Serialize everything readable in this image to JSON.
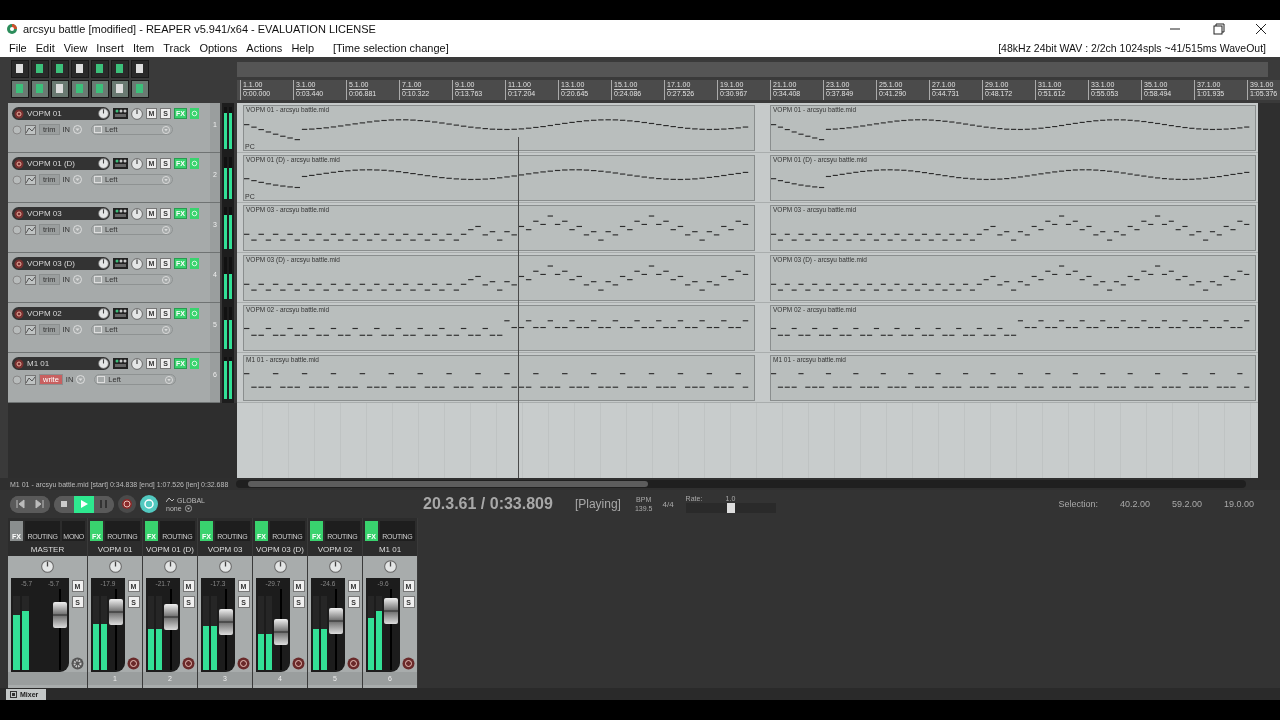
{
  "window": {
    "title": "arcsyu battle [modified] - REAPER v5.941/x64 - EVALUATION LICENSE"
  },
  "menu": [
    "File",
    "Edit",
    "View",
    "Insert",
    "Item",
    "Track",
    "Options",
    "Actions",
    "Help"
  ],
  "last_action": "[Time selection change]",
  "audio_status": "[48kHz 24bit WAV : 2/2ch 1024spls ~41/515ms WaveOut]",
  "ruler": [
    {
      "bar": "1.1.00",
      "time": "0:00.000"
    },
    {
      "bar": "3.1.00",
      "time": "0:03.440"
    },
    {
      "bar": "5.1.00",
      "time": "0:06.881"
    },
    {
      "bar": "7.1.00",
      "time": "0:10.322"
    },
    {
      "bar": "9.1.00",
      "time": "0:13.763"
    },
    {
      "bar": "11.1.00",
      "time": "0:17.204"
    },
    {
      "bar": "13.1.00",
      "time": "0:20.645"
    },
    {
      "bar": "15.1.00",
      "time": "0:24.086"
    },
    {
      "bar": "17.1.00",
      "time": "0:27.526"
    },
    {
      "bar": "19.1.00",
      "time": "0:30.967"
    },
    {
      "bar": "21.1.00",
      "time": "0:34.408"
    },
    {
      "bar": "23.1.00",
      "time": "0:37.849"
    },
    {
      "bar": "25.1.00",
      "time": "0:41.290"
    },
    {
      "bar": "27.1.00",
      "time": "0:44.731"
    },
    {
      "bar": "29.1.00",
      "time": "0:48.172"
    },
    {
      "bar": "31.1.00",
      "time": "0:51.612"
    },
    {
      "bar": "33.1.00",
      "time": "0:55.053"
    },
    {
      "bar": "35.1.00",
      "time": "0:58.494"
    },
    {
      "bar": "37.1.00",
      "time": "1:01.935"
    },
    {
      "bar": "39.1.00",
      "time": "1:05.376"
    }
  ],
  "tracks": [
    {
      "number": "1",
      "name": "VOPM 01",
      "automation": "trim",
      "automation_write": false,
      "input": "IN",
      "output": "Left",
      "mute": "M",
      "solo": "S",
      "fx": "FX",
      "level": 0.85,
      "clips": [
        {
          "name": "VOPM 01 - arcsyu battle.mid",
          "marker": "PC"
        },
        {
          "name": "VOPM 01 - arcsyu battle.mid"
        }
      ]
    },
    {
      "number": "2",
      "name": "VOPM 01 (D)",
      "automation": "trim",
      "automation_write": false,
      "input": "IN",
      "output": "Left",
      "mute": "M",
      "solo": "S",
      "fx": "FX",
      "level": 0.75,
      "clips": [
        {
          "name": "VOPM 01 (D) - arcsyu battle.mid",
          "marker": "PC"
        },
        {
          "name": "VOPM 01 (D) - arcsyu battle.mid"
        }
      ]
    },
    {
      "number": "3",
      "name": "VOPM 03",
      "automation": "trim",
      "automation_write": false,
      "input": "IN",
      "output": "Left",
      "mute": "M",
      "solo": "S",
      "fx": "FX",
      "level": 0.8,
      "clips": [
        {
          "name": "VOPM 03 - arcsyu battle.mid"
        },
        {
          "name": "VOPM 03 - arcsyu battle.mid"
        }
      ]
    },
    {
      "number": "4",
      "name": "VOPM 03 (D)",
      "automation": "trim",
      "automation_write": false,
      "input": "IN",
      "output": "Left",
      "mute": "M",
      "solo": "S",
      "fx": "FX",
      "level": 0.6,
      "clips": [
        {
          "name": "VOPM 03 (D) - arcsyu battle.mid"
        },
        {
          "name": "VOPM 03 (D) - arcsyu battle.mid"
        }
      ]
    },
    {
      "number": "5",
      "name": "VOPM 02",
      "automation": "trim",
      "automation_write": false,
      "input": "IN",
      "output": "Left",
      "mute": "M",
      "solo": "S",
      "fx": "FX",
      "level": 0.7,
      "clips": [
        {
          "name": "VOPM 02 - arcsyu battle.mid"
        },
        {
          "name": "VOPM 02 - arcsyu battle.mid"
        }
      ]
    },
    {
      "number": "6",
      "name": "M1 01",
      "automation": "write",
      "automation_write": true,
      "input": "IN",
      "output": "Left",
      "mute": "M",
      "solo": "S",
      "fx": "FX",
      "level": 0.9,
      "clips": [
        {
          "name": "M1 01 - arcsyu battle.mid"
        },
        {
          "name": "M1 01 - arcsyu battle.mid"
        }
      ]
    }
  ],
  "status_line": "M1 01 - arcsyu battle.mid [start] 0:34.838 [end] 1:07.526 [len] 0:32.688",
  "transport": {
    "buttons": [
      {
        "kind": "prev",
        "on": false
      },
      {
        "kind": "next",
        "on": false
      },
      {
        "kind": "stop",
        "on": false
      },
      {
        "kind": "play",
        "on": true
      },
      {
        "kind": "pause",
        "on": false
      },
      {
        "kind": "record",
        "on": false
      },
      {
        "kind": "repeat",
        "on": true
      }
    ],
    "automation_label": "GLOBAL",
    "automation_mode": "none",
    "position": "20.3.61 / 0:33.809",
    "state": "[Playing]",
    "bpm_label": "BPM",
    "bpm": "139.5",
    "time_signature": "4/4",
    "rate_slider": {
      "label": "Rate:",
      "reading": "1.0",
      "level": 0.5
    },
    "selection": {
      "label": "Selection:",
      "start": "40.2.00",
      "end": "59.2.00",
      "length": "19.0.00"
    }
  },
  "mixer": {
    "strips": [
      {
        "kind": "master",
        "name": "MASTER",
        "fx": "FX",
        "fx_on": false,
        "routing": "ROUTING",
        "extra": "MONO",
        "mute": "M",
        "solo": "S",
        "peaks": [
          "-5.7",
          "-5.7"
        ],
        "meters": [
          {
            "level": 0.75
          },
          {
            "level": 0.8
          }
        ],
        "fader": {
          "level": 0.75
        }
      },
      {
        "kind": "track",
        "name": "VOPM 01",
        "number": "1",
        "fx": "FX",
        "fx_on": true,
        "routing": "ROUTING",
        "mute": "M",
        "solo": "S",
        "peaks": [
          "-17.9"
        ],
        "meters": [
          {
            "level": 0.62
          },
          {
            "level": 0.62
          }
        ],
        "fader": {
          "level": 0.8
        }
      },
      {
        "kind": "track",
        "name": "VOPM 01 (D)",
        "number": "2",
        "fx": "FX",
        "fx_on": true,
        "routing": "ROUTING",
        "mute": "M",
        "solo": "S",
        "peaks": [
          "-21.7"
        ],
        "meters": [
          {
            "level": 0.55
          },
          {
            "level": 0.55
          }
        ],
        "fader": {
          "level": 0.72
        }
      },
      {
        "kind": "track",
        "name": "VOPM 03",
        "number": "3",
        "fx": "FX",
        "fx_on": true,
        "routing": "ROUTING",
        "mute": "M",
        "solo": "S",
        "peaks": [
          "-17.3"
        ],
        "meters": [
          {
            "level": 0.6
          },
          {
            "level": 0.6
          }
        ],
        "fader": {
          "level": 0.62
        }
      },
      {
        "kind": "track",
        "name": "VOPM 03 (D)",
        "number": "4",
        "fx": "FX",
        "fx_on": true,
        "routing": "ROUTING",
        "mute": "M",
        "solo": "S",
        "peaks": [
          "-29.7"
        ],
        "meters": [
          {
            "level": 0.48
          },
          {
            "level": 0.48
          }
        ],
        "fader": {
          "level": 0.45
        }
      },
      {
        "kind": "track",
        "name": "VOPM 02",
        "number": "5",
        "fx": "FX",
        "fx_on": true,
        "routing": "ROUTING",
        "mute": "M",
        "solo": "S",
        "peaks": [
          "-24.6"
        ],
        "meters": [
          {
            "level": 0.55
          },
          {
            "level": 0.55
          }
        ],
        "fader": {
          "level": 0.65
        }
      },
      {
        "kind": "track",
        "name": "M1 01",
        "number": "6",
        "fx": "FX",
        "fx_on": true,
        "routing": "ROUTING",
        "mute": "M",
        "solo": "S",
        "peaks": [
          "-9.6"
        ],
        "meters": [
          {
            "level": 0.7
          },
          {
            "level": 0.8
          }
        ],
        "fader": {
          "level": 0.82
        }
      }
    ]
  },
  "tabs": [
    {
      "label": "Mixer",
      "selected": true
    }
  ]
}
